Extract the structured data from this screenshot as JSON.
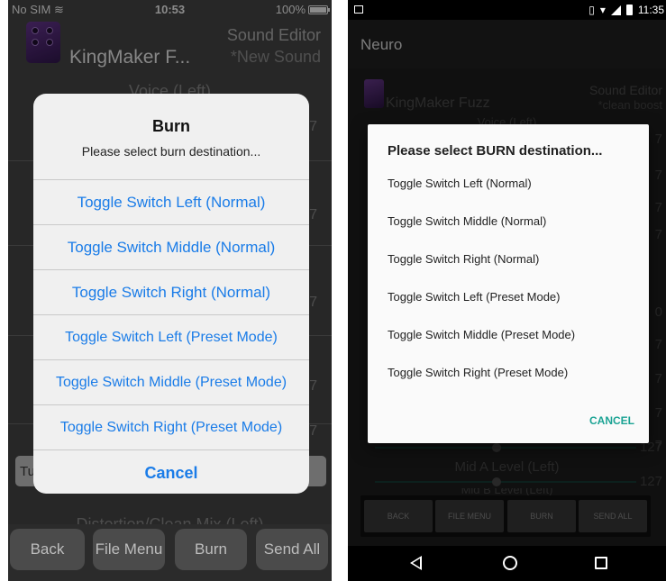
{
  "ios": {
    "status": {
      "carrier": "No SIM",
      "time": "10:53",
      "battery": "100%"
    },
    "header": {
      "app_title": "KingMaker F...",
      "editor_title": "Sound Editor",
      "sound_name": "*New Sound"
    },
    "background": {
      "top_label": "Voice (Left)",
      "bottom_label": "Distortion/Clean Mix (Left)",
      "textbox_value": "Tu",
      "values": [
        "7",
        "7",
        "7",
        "7",
        "7"
      ]
    },
    "alert": {
      "title": "Burn",
      "message": "Please select burn destination...",
      "options": [
        "Toggle Switch Left (Normal)",
        "Toggle Switch Middle (Normal)",
        "Toggle Switch Right (Normal)",
        "Toggle Switch Left (Preset Mode)",
        "Toggle Switch Middle (Preset Mode)",
        "Toggle Switch Right (Preset Mode)"
      ],
      "cancel": "Cancel"
    },
    "toolbar": {
      "back": "Back",
      "file_menu": "File Menu",
      "burn": "Burn",
      "send_all": "Send All"
    }
  },
  "android": {
    "status": {
      "time": "11:35"
    },
    "action_bar_title": "Neuro",
    "header": {
      "app_title": "KingMaker Fuzz",
      "editor_title": "Sound Editor",
      "sound_name": "*clean boost"
    },
    "background": {
      "top_label": "Voice (Left)",
      "mid_label": "Mid A Level (Left)",
      "bottom_label": "Mid B Level (Left)",
      "values": [
        "7",
        "7",
        "7",
        "7",
        "0",
        "7",
        "7",
        "7",
        "7",
        "127",
        "127"
      ]
    },
    "dialog": {
      "title": "Please select BURN destination...",
      "options": [
        "Toggle Switch Left (Normal)",
        "Toggle Switch Middle (Normal)",
        "Toggle Switch Right (Normal)",
        "Toggle Switch Left (Preset Mode)",
        "Toggle Switch Middle (Preset Mode)",
        "Toggle Switch Right (Preset Mode)"
      ],
      "cancel": "CANCEL"
    },
    "toolbar": {
      "back": "BACK",
      "file_menu": "FILE MENU",
      "burn": "BURN",
      "send_all": "SEND ALL"
    }
  }
}
